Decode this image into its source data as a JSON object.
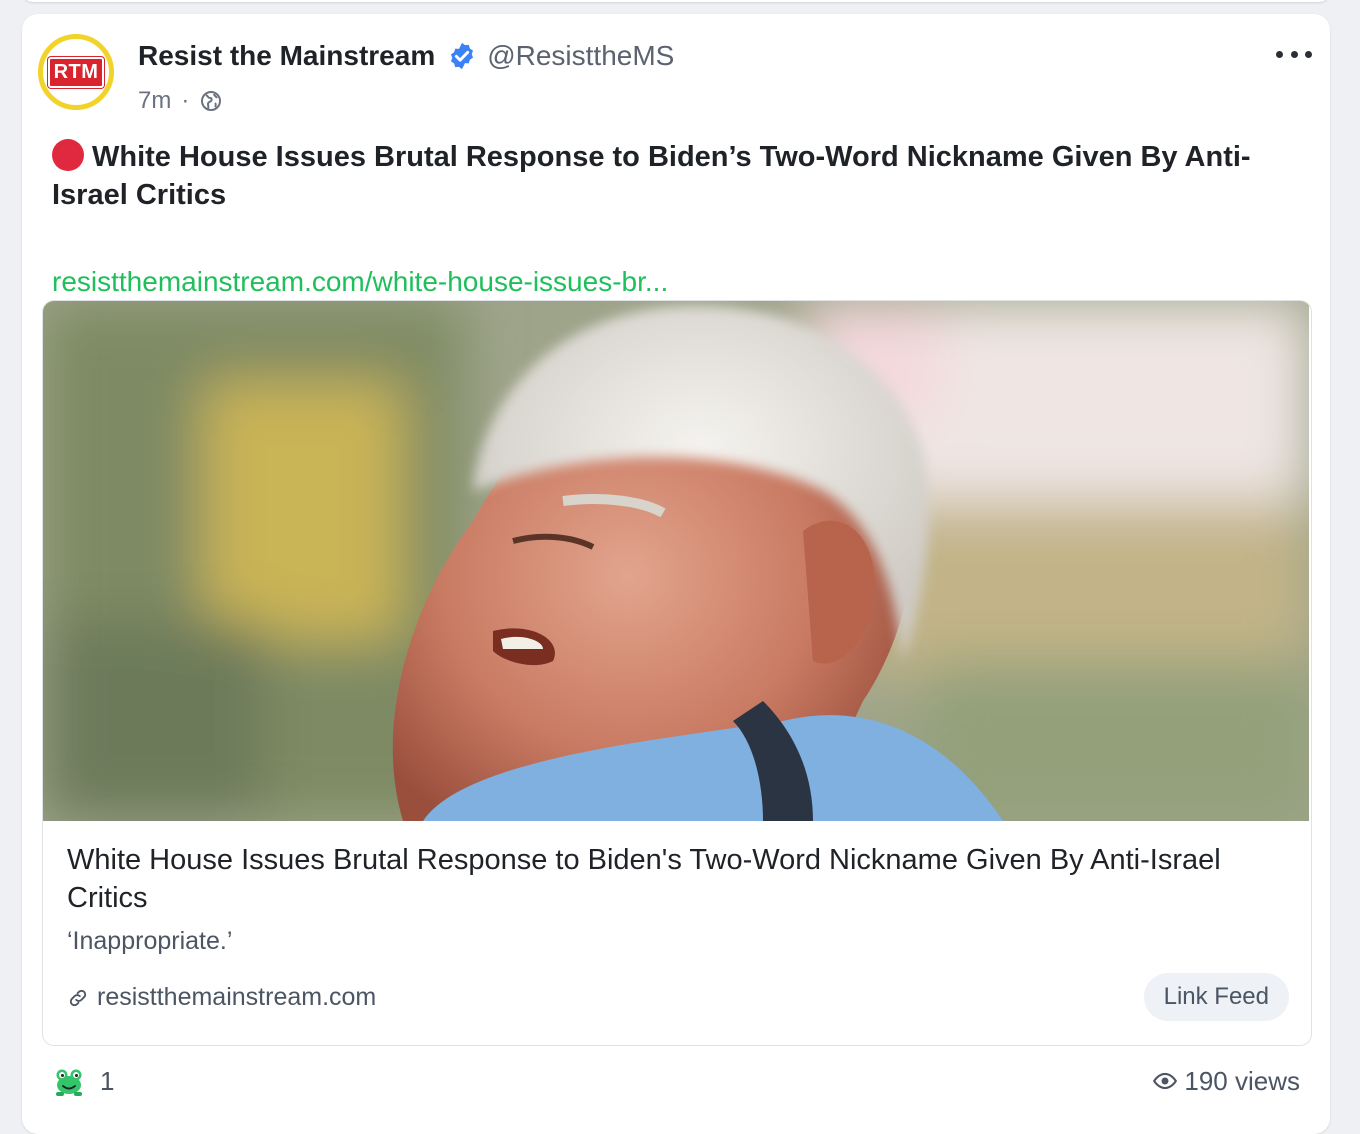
{
  "post": {
    "author_name": "Resist the Mainstream",
    "author_handle": "@ResisttheMS",
    "avatar_text": "RTM",
    "time_ago": "7m",
    "meta_separator": "·",
    "text": "White House Issues Brutal Response to Biden’s Two-Word Nickname Given By Anti-Israel Critics",
    "link_text": "resistthemainstream.com/white-house-issues-br..."
  },
  "preview": {
    "title": "White House Issues Brutal Response to Biden's Two-Word Nickname Given By Anti-Israel Critics",
    "description": "‘Inappropriate.’",
    "domain": "resistthemainstream.com",
    "link_feed_label": "Link Feed"
  },
  "footer": {
    "reaction_count": "1",
    "views": "190 views"
  },
  "icons": {
    "verified": "verified-badge-icon",
    "globe": "globe-icon",
    "more": "more-icon",
    "link": "link-icon",
    "reaction": "frog-icon",
    "views": "eye-icon"
  },
  "colors": {
    "link_green": "#1fbf5c",
    "live_red": "#e0283f",
    "verified_blue": "#3b82f6",
    "avatar_ring": "#f2d32a",
    "brand_red": "#d9232d"
  }
}
